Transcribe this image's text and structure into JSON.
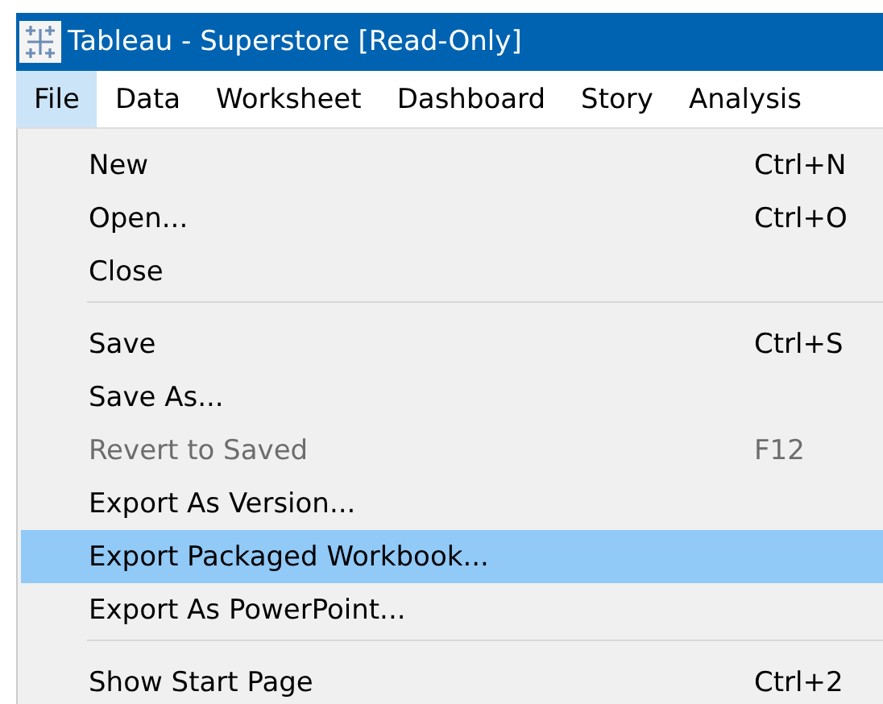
{
  "window": {
    "title": "Tableau - Superstore [Read-Only]"
  },
  "menu_bar": [
    {
      "label": "File",
      "selected": true
    },
    {
      "label": "Data",
      "selected": false
    },
    {
      "label": "Worksheet",
      "selected": false
    },
    {
      "label": "Dashboard",
      "selected": false
    },
    {
      "label": "Story",
      "selected": false
    },
    {
      "label": "Analysis",
      "selected": false
    }
  ],
  "file_menu": [
    {
      "kind": "item",
      "label": "New",
      "shortcut": "Ctrl+N",
      "disabled": false,
      "selected": false
    },
    {
      "kind": "item",
      "label": "Open...",
      "shortcut": "Ctrl+O",
      "disabled": false,
      "selected": false
    },
    {
      "kind": "item",
      "label": "Close",
      "disabled": false,
      "selected": false
    },
    {
      "kind": "separator"
    },
    {
      "kind": "item",
      "label": "Save",
      "shortcut": "Ctrl+S",
      "disabled": false,
      "selected": false
    },
    {
      "kind": "item",
      "label": "Save As...",
      "disabled": false,
      "selected": false
    },
    {
      "kind": "item",
      "label": "Revert to Saved",
      "shortcut": "F12",
      "disabled": true,
      "selected": false
    },
    {
      "kind": "item",
      "label": "Export As Version...",
      "disabled": false,
      "selected": false
    },
    {
      "kind": "item",
      "label": "Export Packaged Workbook...",
      "disabled": false,
      "selected": true
    },
    {
      "kind": "item",
      "label": "Export As PowerPoint...",
      "disabled": false,
      "selected": false
    },
    {
      "kind": "separator"
    },
    {
      "kind": "item",
      "label": "Show Start Page",
      "shortcut": "Ctrl+2",
      "disabled": false,
      "selected": false
    }
  ]
}
